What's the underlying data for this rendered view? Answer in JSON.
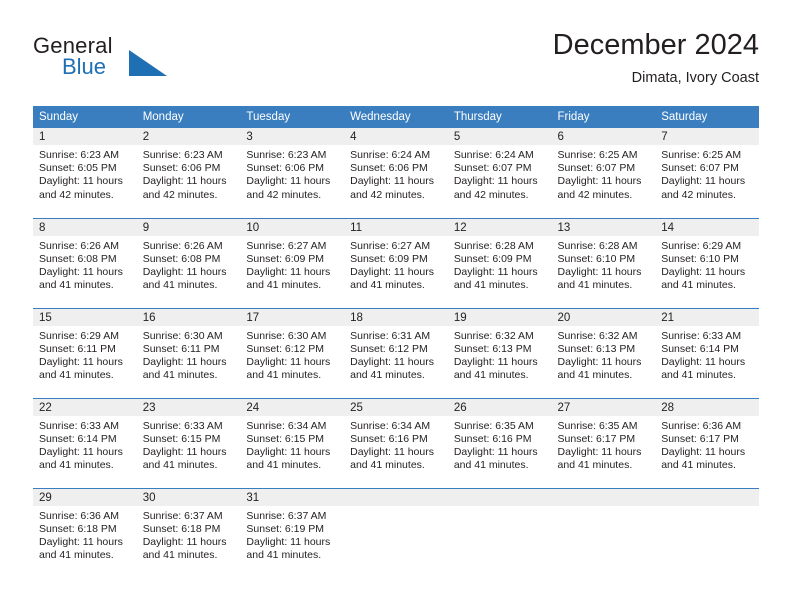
{
  "brand": {
    "name_part1": "General",
    "name_part2": "Blue",
    "triangle_color": "#1f6fb4"
  },
  "header": {
    "title": "December 2024",
    "subtitle": "Dimata, Ivory Coast"
  },
  "colors": {
    "header_row_bg": "#3a7ebf",
    "day_number_bg": "#efefef",
    "text": "#231f20",
    "accent_blue": "#1f6fb4"
  },
  "weekdays": [
    "Sunday",
    "Monday",
    "Tuesday",
    "Wednesday",
    "Thursday",
    "Friday",
    "Saturday"
  ],
  "weeks": [
    [
      {
        "day": "1",
        "sunrise": "Sunrise: 6:23 AM",
        "sunset": "Sunset: 6:05 PM",
        "daylight1": "Daylight: 11 hours",
        "daylight2": "and 42 minutes."
      },
      {
        "day": "2",
        "sunrise": "Sunrise: 6:23 AM",
        "sunset": "Sunset: 6:06 PM",
        "daylight1": "Daylight: 11 hours",
        "daylight2": "and 42 minutes."
      },
      {
        "day": "3",
        "sunrise": "Sunrise: 6:23 AM",
        "sunset": "Sunset: 6:06 PM",
        "daylight1": "Daylight: 11 hours",
        "daylight2": "and 42 minutes."
      },
      {
        "day": "4",
        "sunrise": "Sunrise: 6:24 AM",
        "sunset": "Sunset: 6:06 PM",
        "daylight1": "Daylight: 11 hours",
        "daylight2": "and 42 minutes."
      },
      {
        "day": "5",
        "sunrise": "Sunrise: 6:24 AM",
        "sunset": "Sunset: 6:07 PM",
        "daylight1": "Daylight: 11 hours",
        "daylight2": "and 42 minutes."
      },
      {
        "day": "6",
        "sunrise": "Sunrise: 6:25 AM",
        "sunset": "Sunset: 6:07 PM",
        "daylight1": "Daylight: 11 hours",
        "daylight2": "and 42 minutes."
      },
      {
        "day": "7",
        "sunrise": "Sunrise: 6:25 AM",
        "sunset": "Sunset: 6:07 PM",
        "daylight1": "Daylight: 11 hours",
        "daylight2": "and 42 minutes."
      }
    ],
    [
      {
        "day": "8",
        "sunrise": "Sunrise: 6:26 AM",
        "sunset": "Sunset: 6:08 PM",
        "daylight1": "Daylight: 11 hours",
        "daylight2": "and 41 minutes."
      },
      {
        "day": "9",
        "sunrise": "Sunrise: 6:26 AM",
        "sunset": "Sunset: 6:08 PM",
        "daylight1": "Daylight: 11 hours",
        "daylight2": "and 41 minutes."
      },
      {
        "day": "10",
        "sunrise": "Sunrise: 6:27 AM",
        "sunset": "Sunset: 6:09 PM",
        "daylight1": "Daylight: 11 hours",
        "daylight2": "and 41 minutes."
      },
      {
        "day": "11",
        "sunrise": "Sunrise: 6:27 AM",
        "sunset": "Sunset: 6:09 PM",
        "daylight1": "Daylight: 11 hours",
        "daylight2": "and 41 minutes."
      },
      {
        "day": "12",
        "sunrise": "Sunrise: 6:28 AM",
        "sunset": "Sunset: 6:09 PM",
        "daylight1": "Daylight: 11 hours",
        "daylight2": "and 41 minutes."
      },
      {
        "day": "13",
        "sunrise": "Sunrise: 6:28 AM",
        "sunset": "Sunset: 6:10 PM",
        "daylight1": "Daylight: 11 hours",
        "daylight2": "and 41 minutes."
      },
      {
        "day": "14",
        "sunrise": "Sunrise: 6:29 AM",
        "sunset": "Sunset: 6:10 PM",
        "daylight1": "Daylight: 11 hours",
        "daylight2": "and 41 minutes."
      }
    ],
    [
      {
        "day": "15",
        "sunrise": "Sunrise: 6:29 AM",
        "sunset": "Sunset: 6:11 PM",
        "daylight1": "Daylight: 11 hours",
        "daylight2": "and 41 minutes."
      },
      {
        "day": "16",
        "sunrise": "Sunrise: 6:30 AM",
        "sunset": "Sunset: 6:11 PM",
        "daylight1": "Daylight: 11 hours",
        "daylight2": "and 41 minutes."
      },
      {
        "day": "17",
        "sunrise": "Sunrise: 6:30 AM",
        "sunset": "Sunset: 6:12 PM",
        "daylight1": "Daylight: 11 hours",
        "daylight2": "and 41 minutes."
      },
      {
        "day": "18",
        "sunrise": "Sunrise: 6:31 AM",
        "sunset": "Sunset: 6:12 PM",
        "daylight1": "Daylight: 11 hours",
        "daylight2": "and 41 minutes."
      },
      {
        "day": "19",
        "sunrise": "Sunrise: 6:32 AM",
        "sunset": "Sunset: 6:13 PM",
        "daylight1": "Daylight: 11 hours",
        "daylight2": "and 41 minutes."
      },
      {
        "day": "20",
        "sunrise": "Sunrise: 6:32 AM",
        "sunset": "Sunset: 6:13 PM",
        "daylight1": "Daylight: 11 hours",
        "daylight2": "and 41 minutes."
      },
      {
        "day": "21",
        "sunrise": "Sunrise: 6:33 AM",
        "sunset": "Sunset: 6:14 PM",
        "daylight1": "Daylight: 11 hours",
        "daylight2": "and 41 minutes."
      }
    ],
    [
      {
        "day": "22",
        "sunrise": "Sunrise: 6:33 AM",
        "sunset": "Sunset: 6:14 PM",
        "daylight1": "Daylight: 11 hours",
        "daylight2": "and 41 minutes."
      },
      {
        "day": "23",
        "sunrise": "Sunrise: 6:33 AM",
        "sunset": "Sunset: 6:15 PM",
        "daylight1": "Daylight: 11 hours",
        "daylight2": "and 41 minutes."
      },
      {
        "day": "24",
        "sunrise": "Sunrise: 6:34 AM",
        "sunset": "Sunset: 6:15 PM",
        "daylight1": "Daylight: 11 hours",
        "daylight2": "and 41 minutes."
      },
      {
        "day": "25",
        "sunrise": "Sunrise: 6:34 AM",
        "sunset": "Sunset: 6:16 PM",
        "daylight1": "Daylight: 11 hours",
        "daylight2": "and 41 minutes."
      },
      {
        "day": "26",
        "sunrise": "Sunrise: 6:35 AM",
        "sunset": "Sunset: 6:16 PM",
        "daylight1": "Daylight: 11 hours",
        "daylight2": "and 41 minutes."
      },
      {
        "day": "27",
        "sunrise": "Sunrise: 6:35 AM",
        "sunset": "Sunset: 6:17 PM",
        "daylight1": "Daylight: 11 hours",
        "daylight2": "and 41 minutes."
      },
      {
        "day": "28",
        "sunrise": "Sunrise: 6:36 AM",
        "sunset": "Sunset: 6:17 PM",
        "daylight1": "Daylight: 11 hours",
        "daylight2": "and 41 minutes."
      }
    ],
    [
      {
        "day": "29",
        "sunrise": "Sunrise: 6:36 AM",
        "sunset": "Sunset: 6:18 PM",
        "daylight1": "Daylight: 11 hours",
        "daylight2": "and 41 minutes."
      },
      {
        "day": "30",
        "sunrise": "Sunrise: 6:37 AM",
        "sunset": "Sunset: 6:18 PM",
        "daylight1": "Daylight: 11 hours",
        "daylight2": "and 41 minutes."
      },
      {
        "day": "31",
        "sunrise": "Sunrise: 6:37 AM",
        "sunset": "Sunset: 6:19 PM",
        "daylight1": "Daylight: 11 hours",
        "daylight2": "and 41 minutes."
      },
      {
        "day": "",
        "sunrise": "",
        "sunset": "",
        "daylight1": "",
        "daylight2": ""
      },
      {
        "day": "",
        "sunrise": "",
        "sunset": "",
        "daylight1": "",
        "daylight2": ""
      },
      {
        "day": "",
        "sunrise": "",
        "sunset": "",
        "daylight1": "",
        "daylight2": ""
      },
      {
        "day": "",
        "sunrise": "",
        "sunset": "",
        "daylight1": "",
        "daylight2": ""
      }
    ]
  ]
}
